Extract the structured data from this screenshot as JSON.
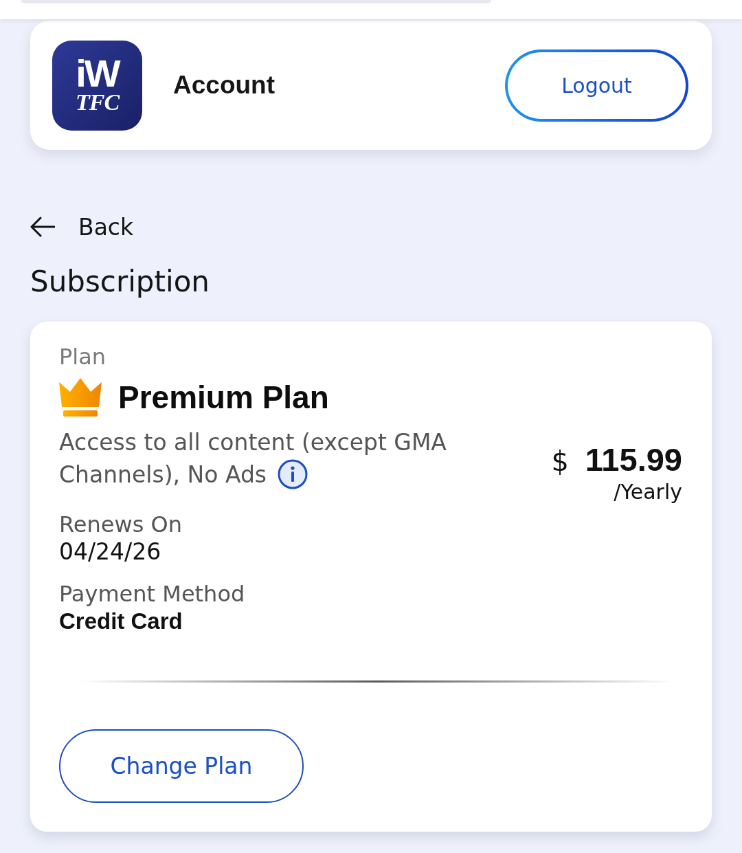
{
  "header": {
    "logo": {
      "mark": "iW",
      "name": "TFC"
    },
    "title": "Account",
    "logout_button": "Logout"
  },
  "back_link": "Back",
  "page_title": "Subscription",
  "subscription": {
    "plan_label": "Plan",
    "plan_name": "Premium Plan",
    "description": "Access to all content (except GMA Channels), No Ads",
    "price": {
      "currency": "$",
      "amount": "115.99",
      "period": "/Yearly"
    },
    "details": [
      {
        "label": "Renews On",
        "value": "04/24/26"
      },
      {
        "label": "Payment Method",
        "value": "Credit Card"
      }
    ],
    "change_plan_button": "Change Plan"
  }
}
